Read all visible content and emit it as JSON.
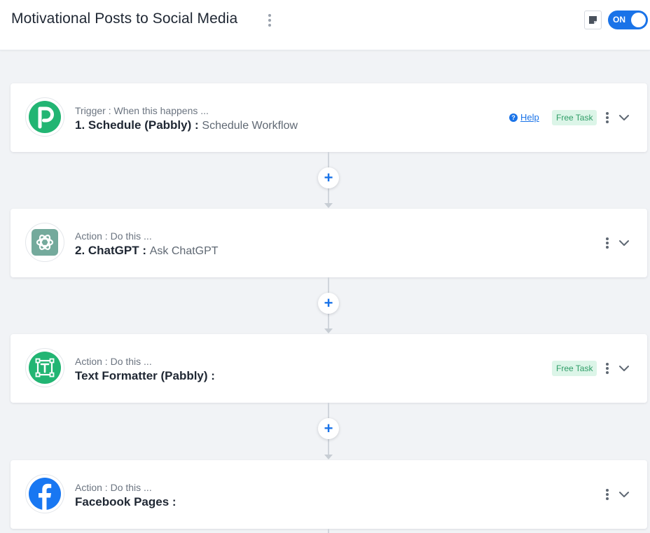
{
  "header": {
    "title": "Motivational Posts to Social Media",
    "toggle_label": "ON",
    "toggle_state": "on",
    "accent_color": "#1a73e8"
  },
  "steps": [
    {
      "subtitle": "Trigger : When this happens ...",
      "title": "1. Schedule (Pabbly) :",
      "event": "Schedule Workflow",
      "icon": "pabbly-schedule-icon",
      "help_label": "Help",
      "badge": "Free Task"
    },
    {
      "subtitle": "Action : Do this ...",
      "title": "2. ChatGPT :",
      "event": "Ask ChatGPT",
      "icon": "chatgpt-icon"
    },
    {
      "subtitle": "Action : Do this ...",
      "title": "Text Formatter (Pabbly) :",
      "event": "",
      "icon": "text-formatter-icon",
      "badge": "Free Task"
    },
    {
      "subtitle": "Action : Do this ...",
      "title": "Facebook Pages :",
      "event": "",
      "icon": "facebook-icon"
    }
  ],
  "add_step_symbol": "+",
  "colors": {
    "pabbly_green": "#22b573",
    "chatgpt_teal": "#74aa9c",
    "text_formatter_green": "#22b573",
    "facebook_blue": "#1877f2",
    "free_task_bg": "#dcf5e8",
    "free_task_text": "#2f9d67"
  }
}
